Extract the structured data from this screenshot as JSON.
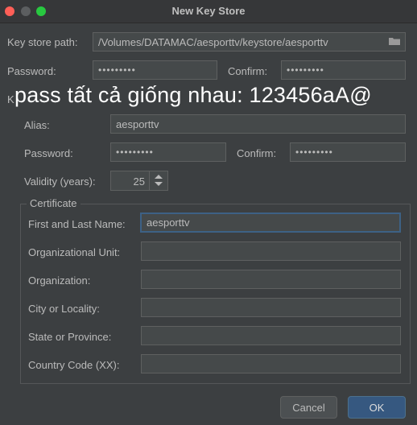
{
  "window": {
    "title": "New Key Store"
  },
  "keystore": {
    "path_label": "Key store path:",
    "path_value": "/Volumes/DATAMAC/aesporttv/keystore/aesporttv",
    "password_label": "Password:",
    "password_value": "•••••••••",
    "confirm_label": "Confirm:",
    "confirm_value": "•••••••••",
    "key_section_label_partial": "K"
  },
  "overlay_text": "pass tất cả giống nhau: 123456aA@",
  "key": {
    "alias_label": "Alias:",
    "alias_value": "aesporttv",
    "password_label": "Password:",
    "password_value": "•••••••••",
    "confirm_label": "Confirm:",
    "confirm_value": "•••••••••",
    "validity_label": "Validity (years):",
    "validity_value": "25"
  },
  "certificate": {
    "legend": "Certificate",
    "first_last_label": "First and Last Name:",
    "first_last_value": "aesporttv",
    "org_unit_label": "Organizational Unit:",
    "org_unit_value": "",
    "org_label": "Organization:",
    "org_value": "",
    "city_label": "City or Locality:",
    "city_value": "",
    "state_label": "State or Province:",
    "state_value": "",
    "country_label": "Country Code (XX):",
    "country_value": ""
  },
  "buttons": {
    "cancel": "Cancel",
    "ok": "OK"
  },
  "colors": {
    "background": "#3c3f41",
    "field": "#45494a",
    "ok_button": "#365880",
    "focus": "#3d6185"
  }
}
